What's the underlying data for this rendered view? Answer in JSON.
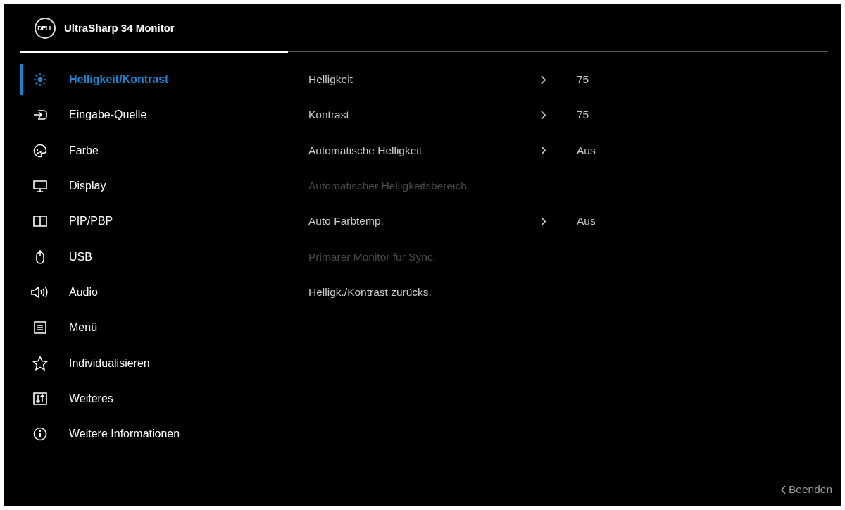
{
  "header": {
    "logo_text": "DELL",
    "title": "UltraSharp 34 Monitor"
  },
  "menu": [
    {
      "label": "Helligkeit/Kontrast",
      "selected": true
    },
    {
      "label": "Eingabe-Quelle",
      "selected": false
    },
    {
      "label": "Farbe",
      "selected": false
    },
    {
      "label": "Display",
      "selected": false
    },
    {
      "label": "PIP/PBP",
      "selected": false
    },
    {
      "label": "USB",
      "selected": false
    },
    {
      "label": "Audio",
      "selected": false
    },
    {
      "label": "Menü",
      "selected": false
    },
    {
      "label": "Individualisieren",
      "selected": false
    },
    {
      "label": "Weiteres",
      "selected": false
    },
    {
      "label": "Weitere Informationen",
      "selected": false
    }
  ],
  "settings": [
    {
      "label": "Helligkeit",
      "disabled": false,
      "value": "75"
    },
    {
      "label": "Kontrast",
      "disabled": false,
      "value": "75"
    },
    {
      "label": "Automatische Helligkeit",
      "disabled": false,
      "value": "Aus"
    },
    {
      "label": "Automatischer Helligkeitsbereich",
      "disabled": true
    },
    {
      "label": "Auto Farbtemp.",
      "disabled": false,
      "value": "Aus"
    },
    {
      "label": "Primärer Monitor für Sync.",
      "disabled": true
    },
    {
      "label": "Helligk./Kontrast zurücks.",
      "disabled": false
    }
  ],
  "footer": {
    "exit_label": "Beenden"
  }
}
